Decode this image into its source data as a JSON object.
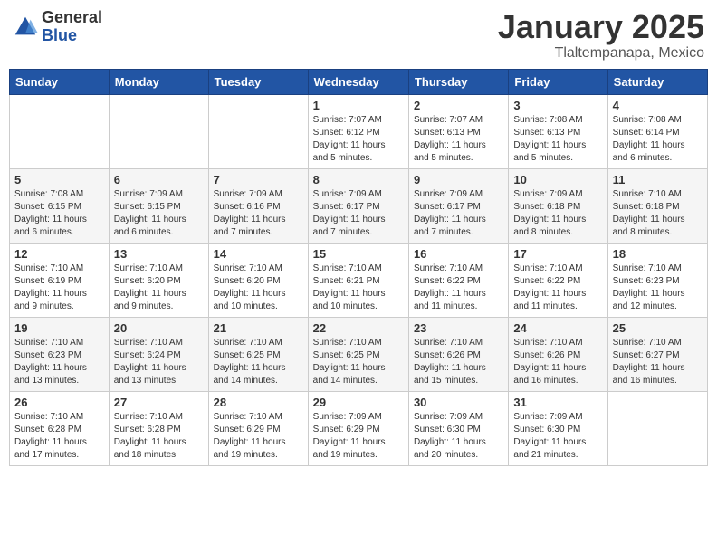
{
  "logo": {
    "general": "General",
    "blue": "Blue"
  },
  "header": {
    "month": "January 2025",
    "location": "Tlaltempanapa, Mexico"
  },
  "weekdays": [
    "Sunday",
    "Monday",
    "Tuesday",
    "Wednesday",
    "Thursday",
    "Friday",
    "Saturday"
  ],
  "weeks": [
    [
      {
        "day": "",
        "info": ""
      },
      {
        "day": "",
        "info": ""
      },
      {
        "day": "",
        "info": ""
      },
      {
        "day": "1",
        "info": "Sunrise: 7:07 AM\nSunset: 6:12 PM\nDaylight: 11 hours\nand 5 minutes."
      },
      {
        "day": "2",
        "info": "Sunrise: 7:07 AM\nSunset: 6:13 PM\nDaylight: 11 hours\nand 5 minutes."
      },
      {
        "day": "3",
        "info": "Sunrise: 7:08 AM\nSunset: 6:13 PM\nDaylight: 11 hours\nand 5 minutes."
      },
      {
        "day": "4",
        "info": "Sunrise: 7:08 AM\nSunset: 6:14 PM\nDaylight: 11 hours\nand 6 minutes."
      }
    ],
    [
      {
        "day": "5",
        "info": "Sunrise: 7:08 AM\nSunset: 6:15 PM\nDaylight: 11 hours\nand 6 minutes."
      },
      {
        "day": "6",
        "info": "Sunrise: 7:09 AM\nSunset: 6:15 PM\nDaylight: 11 hours\nand 6 minutes."
      },
      {
        "day": "7",
        "info": "Sunrise: 7:09 AM\nSunset: 6:16 PM\nDaylight: 11 hours\nand 7 minutes."
      },
      {
        "day": "8",
        "info": "Sunrise: 7:09 AM\nSunset: 6:17 PM\nDaylight: 11 hours\nand 7 minutes."
      },
      {
        "day": "9",
        "info": "Sunrise: 7:09 AM\nSunset: 6:17 PM\nDaylight: 11 hours\nand 7 minutes."
      },
      {
        "day": "10",
        "info": "Sunrise: 7:09 AM\nSunset: 6:18 PM\nDaylight: 11 hours\nand 8 minutes."
      },
      {
        "day": "11",
        "info": "Sunrise: 7:10 AM\nSunset: 6:18 PM\nDaylight: 11 hours\nand 8 minutes."
      }
    ],
    [
      {
        "day": "12",
        "info": "Sunrise: 7:10 AM\nSunset: 6:19 PM\nDaylight: 11 hours\nand 9 minutes."
      },
      {
        "day": "13",
        "info": "Sunrise: 7:10 AM\nSunset: 6:20 PM\nDaylight: 11 hours\nand 9 minutes."
      },
      {
        "day": "14",
        "info": "Sunrise: 7:10 AM\nSunset: 6:20 PM\nDaylight: 11 hours\nand 10 minutes."
      },
      {
        "day": "15",
        "info": "Sunrise: 7:10 AM\nSunset: 6:21 PM\nDaylight: 11 hours\nand 10 minutes."
      },
      {
        "day": "16",
        "info": "Sunrise: 7:10 AM\nSunset: 6:22 PM\nDaylight: 11 hours\nand 11 minutes."
      },
      {
        "day": "17",
        "info": "Sunrise: 7:10 AM\nSunset: 6:22 PM\nDaylight: 11 hours\nand 11 minutes."
      },
      {
        "day": "18",
        "info": "Sunrise: 7:10 AM\nSunset: 6:23 PM\nDaylight: 11 hours\nand 12 minutes."
      }
    ],
    [
      {
        "day": "19",
        "info": "Sunrise: 7:10 AM\nSunset: 6:23 PM\nDaylight: 11 hours\nand 13 minutes."
      },
      {
        "day": "20",
        "info": "Sunrise: 7:10 AM\nSunset: 6:24 PM\nDaylight: 11 hours\nand 13 minutes."
      },
      {
        "day": "21",
        "info": "Sunrise: 7:10 AM\nSunset: 6:25 PM\nDaylight: 11 hours\nand 14 minutes."
      },
      {
        "day": "22",
        "info": "Sunrise: 7:10 AM\nSunset: 6:25 PM\nDaylight: 11 hours\nand 14 minutes."
      },
      {
        "day": "23",
        "info": "Sunrise: 7:10 AM\nSunset: 6:26 PM\nDaylight: 11 hours\nand 15 minutes."
      },
      {
        "day": "24",
        "info": "Sunrise: 7:10 AM\nSunset: 6:26 PM\nDaylight: 11 hours\nand 16 minutes."
      },
      {
        "day": "25",
        "info": "Sunrise: 7:10 AM\nSunset: 6:27 PM\nDaylight: 11 hours\nand 16 minutes."
      }
    ],
    [
      {
        "day": "26",
        "info": "Sunrise: 7:10 AM\nSunset: 6:28 PM\nDaylight: 11 hours\nand 17 minutes."
      },
      {
        "day": "27",
        "info": "Sunrise: 7:10 AM\nSunset: 6:28 PM\nDaylight: 11 hours\nand 18 minutes."
      },
      {
        "day": "28",
        "info": "Sunrise: 7:10 AM\nSunset: 6:29 PM\nDaylight: 11 hours\nand 19 minutes."
      },
      {
        "day": "29",
        "info": "Sunrise: 7:09 AM\nSunset: 6:29 PM\nDaylight: 11 hours\nand 19 minutes."
      },
      {
        "day": "30",
        "info": "Sunrise: 7:09 AM\nSunset: 6:30 PM\nDaylight: 11 hours\nand 20 minutes."
      },
      {
        "day": "31",
        "info": "Sunrise: 7:09 AM\nSunset: 6:30 PM\nDaylight: 11 hours\nand 21 minutes."
      },
      {
        "day": "",
        "info": ""
      }
    ]
  ]
}
